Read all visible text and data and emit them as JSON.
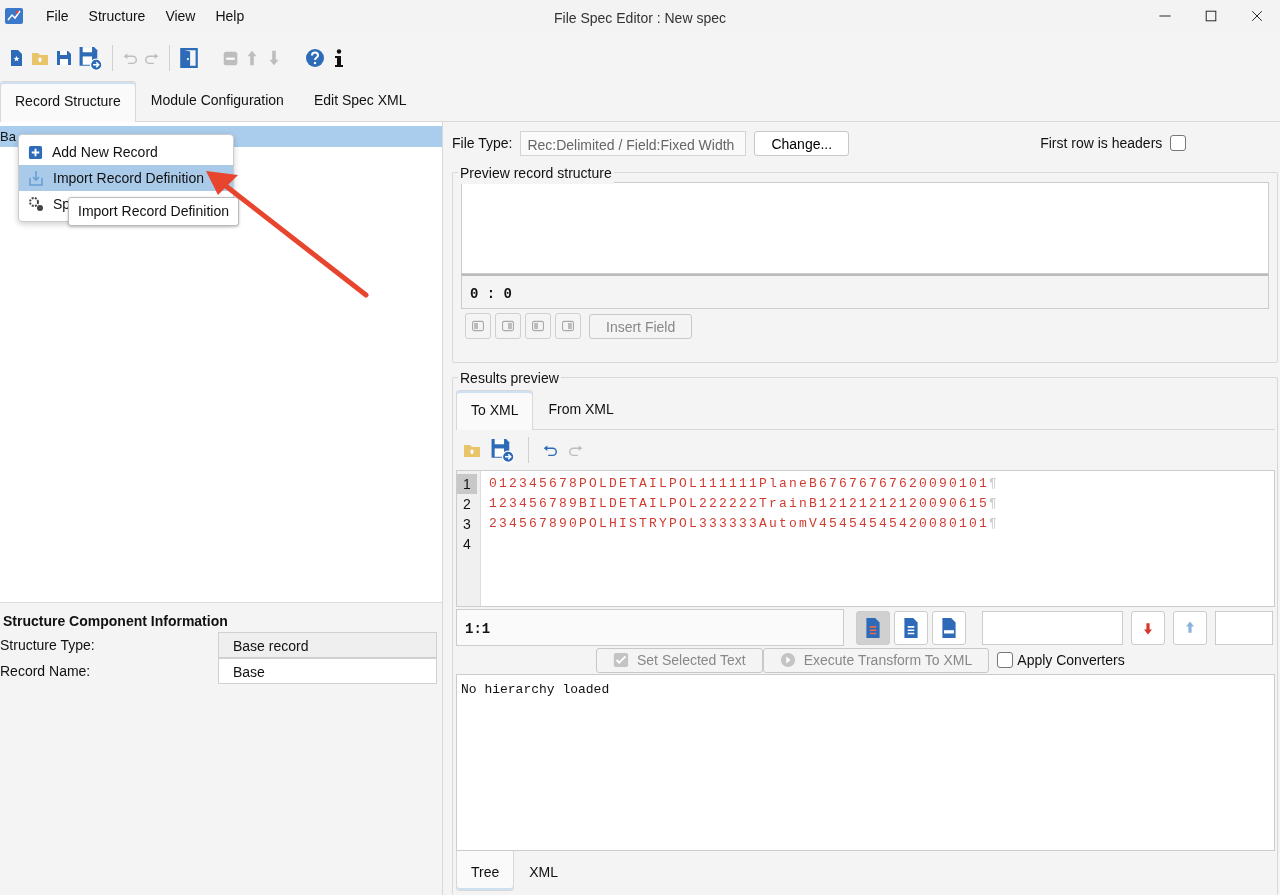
{
  "window": {
    "title": "File Spec Editor : New spec"
  },
  "menu": [
    "File",
    "Structure",
    "View",
    "Help"
  ],
  "toolbar": [
    {
      "kind": "new",
      "disabled": false
    },
    {
      "kind": "open",
      "disabled": false
    },
    {
      "kind": "save",
      "disabled": false
    },
    {
      "kind": "saveas",
      "disabled": false
    },
    {
      "kind": "sep"
    },
    {
      "kind": "undo",
      "disabled": true
    },
    {
      "kind": "redo",
      "disabled": true
    },
    {
      "kind": "sep"
    },
    {
      "kind": "door",
      "disabled": false
    },
    {
      "kind": "gap"
    },
    {
      "kind": "remove",
      "disabled": true
    },
    {
      "kind": "up",
      "disabled": true
    },
    {
      "kind": "down",
      "disabled": true
    },
    {
      "kind": "gap"
    },
    {
      "kind": "help",
      "disabled": false
    },
    {
      "kind": "info",
      "disabled": false
    }
  ],
  "tabs": [
    {
      "label": "Record Structure",
      "selected": true
    },
    {
      "label": "Module Configuration",
      "selected": false
    },
    {
      "label": "Edit Spec XML",
      "selected": false
    }
  ],
  "tree": {
    "items": [
      {
        "label": "Ba",
        "selected": true
      }
    ]
  },
  "context_menu": {
    "items": [
      {
        "label": "Add New Record",
        "kind": "add",
        "selected": false
      },
      {
        "label": "Import Record Definition",
        "kind": "import",
        "selected": true
      },
      {
        "label": "Sp",
        "kind": "settings",
        "selected": false
      }
    ]
  },
  "tooltip": {
    "text": "Import Record Definition"
  },
  "component_info": {
    "title": "Structure Component Information",
    "fields": [
      {
        "label": "Structure Type:",
        "value": "Base record",
        "disabled": true
      },
      {
        "label": "Record Name:",
        "value": "Base",
        "disabled": false
      }
    ]
  },
  "file_type": {
    "label": "File Type:",
    "value": "Rec:Delimited / Field:Fixed Width",
    "button": "Change...",
    "headers_label": "First row is headers",
    "headers_checked": false
  },
  "preview": {
    "title": "Preview record structure",
    "position": "0 : 0",
    "insert_button": "Insert Field"
  },
  "results": {
    "title": "Results preview",
    "tabs": [
      {
        "label": "To XML",
        "selected": true
      },
      {
        "label": "From XML",
        "selected": false
      }
    ],
    "lines": [
      {
        "number": "1",
        "text": "012345678POLDETAILPOL111111PlaneB67676767620090101",
        "eol": "¶",
        "selected": true
      },
      {
        "number": "2",
        "text": "123456789BILDETAILPOL222222TrainB12121212120090615",
        "eol": "¶",
        "selected": false
      },
      {
        "number": "3",
        "text": "234567890POLHISTRYPOL333333AutomV45454545420080101",
        "eol": "¶",
        "selected": false
      },
      {
        "number": "4",
        "selected": false
      }
    ],
    "cursor": "1:1",
    "formats": [
      {
        "kind": "text",
        "selected": true
      },
      {
        "kind": "list",
        "selected": false
      },
      {
        "kind": "html",
        "selected": false
      }
    ],
    "set_selected_button": {
      "label": "Set Selected Text",
      "disabled": true
    },
    "execute_button": {
      "label": "Execute Transform To XML",
      "disabled": true
    },
    "apply_converters": {
      "label": "Apply Converters",
      "checked": false
    },
    "hierarchy": "No hierarchy loaded",
    "bottom_tabs": [
      {
        "label": "Tree",
        "selected": true
      },
      {
        "label": "XML",
        "selected": false
      }
    ]
  }
}
